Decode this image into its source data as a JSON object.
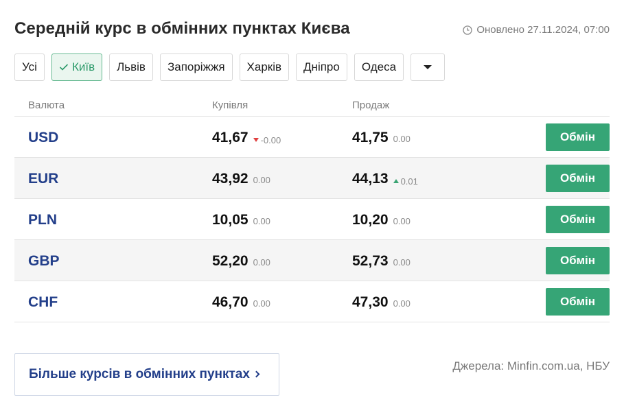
{
  "header": {
    "title": "Середній курс в обмінних пунктах Києва",
    "updated": "Оновлено 27.11.2024, 07:00"
  },
  "tabs": [
    {
      "label": "Усі",
      "active": false
    },
    {
      "label": "Київ",
      "active": true
    },
    {
      "label": "Львів",
      "active": false
    },
    {
      "label": "Запоріжжя",
      "active": false
    },
    {
      "label": "Харків",
      "active": false
    },
    {
      "label": "Дніпро",
      "active": false
    },
    {
      "label": "Одеса",
      "active": false
    }
  ],
  "dropdown_icon": "caret-down",
  "table": {
    "columns": {
      "currency": "Валюта",
      "buy": "Купівля",
      "sell": "Продаж"
    },
    "rows": [
      {
        "code": "USD",
        "buy": "41,67",
        "buy_delta": "-0.00",
        "buy_trend": "down",
        "sell": "41,75",
        "sell_delta": "0.00",
        "sell_trend": "none",
        "action": "Обмін"
      },
      {
        "code": "EUR",
        "buy": "43,92",
        "buy_delta": "0.00",
        "buy_trend": "none",
        "sell": "44,13",
        "sell_delta": "0.01",
        "sell_trend": "up",
        "action": "Обмін"
      },
      {
        "code": "PLN",
        "buy": "10,05",
        "buy_delta": "0.00",
        "buy_trend": "none",
        "sell": "10,20",
        "sell_delta": "0.00",
        "sell_trend": "none",
        "action": "Обмін"
      },
      {
        "code": "GBP",
        "buy": "52,20",
        "buy_delta": "0.00",
        "buy_trend": "none",
        "sell": "52,73",
        "sell_delta": "0.00",
        "sell_trend": "none",
        "action": "Обмін"
      },
      {
        "code": "CHF",
        "buy": "46,70",
        "buy_delta": "0.00",
        "buy_trend": "none",
        "sell": "47,30",
        "sell_delta": "0.00",
        "sell_trend": "none",
        "action": "Обмін"
      }
    ]
  },
  "footer": {
    "more_link": "Більше курсів в обмінних пунктах",
    "sources": "Джерела: Minfin.com.ua, НБУ"
  },
  "colors": {
    "accent_green": "#36a576",
    "link_blue": "#233f8a",
    "trend_down": "#e04040",
    "trend_up": "#3aa473"
  }
}
